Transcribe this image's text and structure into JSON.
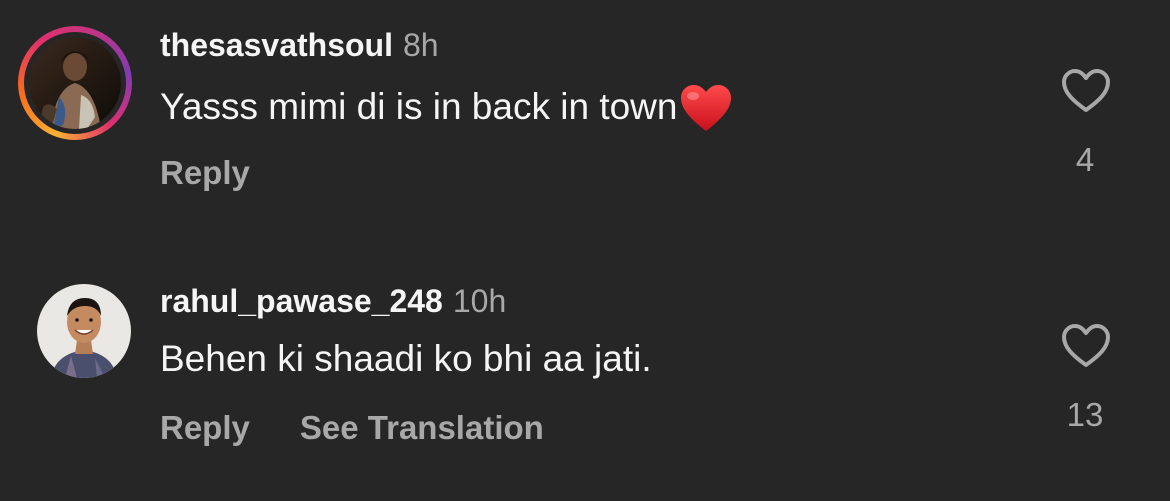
{
  "comments": [
    {
      "username": "thesasvathsoul",
      "time": "8h",
      "text": "Yasss mimi di is in back in town",
      "emoji": "red-heart",
      "has_story_ring": true,
      "actions": [
        "Reply"
      ],
      "like_icon": "heart-outline-icon",
      "like_count": "4"
    },
    {
      "username": "rahul_pawase_248",
      "time": "10h",
      "text": "Behen ki shaadi ko bhi aa jati.",
      "has_story_ring": false,
      "actions": [
        "Reply",
        "See Translation"
      ],
      "like_icon": "heart-outline-icon",
      "like_count": "13"
    }
  ],
  "colors": {
    "background": "#262626",
    "primary_text": "#f5f5f5",
    "secondary_text": "#a8a8a8",
    "heart_emoji": "#e0202f"
  }
}
